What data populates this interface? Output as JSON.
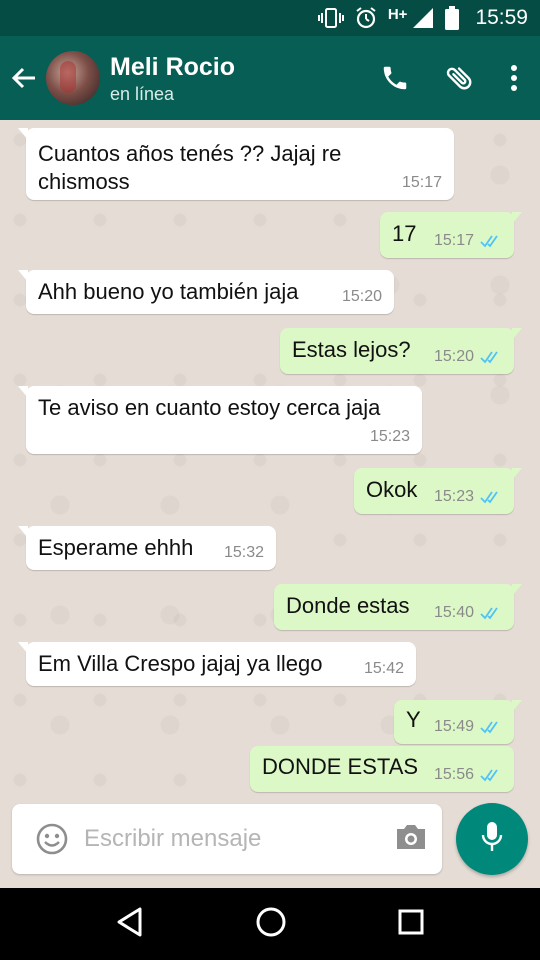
{
  "status_bar": {
    "time": "15:59",
    "network": "H+",
    "icons": [
      "vibrate-icon",
      "alarm-icon",
      "signal-icon",
      "battery-icon"
    ]
  },
  "header": {
    "contact_name": "Meli Rocio",
    "status": "en línea",
    "icons": [
      "back-arrow-icon",
      "phone-icon",
      "attach-icon",
      "more-icon"
    ]
  },
  "messages": [
    {
      "dir": "in",
      "text_lines": [
        "Cuantos años tenés ?? Jajaj re",
        "chismoss"
      ],
      "time": "15:17"
    },
    {
      "dir": "out",
      "text_lines": [
        "17"
      ],
      "time": "15:17",
      "status": "read"
    },
    {
      "dir": "in",
      "text_lines": [
        "Ahh bueno yo también jaja"
      ],
      "time": "15:20"
    },
    {
      "dir": "out",
      "text_lines": [
        "Estas lejos?"
      ],
      "time": "15:20",
      "status": "read"
    },
    {
      "dir": "in",
      "text_lines": [
        "Te aviso en cuanto estoy cerca jaja"
      ],
      "time": "15:23"
    },
    {
      "dir": "out",
      "text_lines": [
        "Okok"
      ],
      "time": "15:23",
      "status": "read"
    },
    {
      "dir": "in",
      "text_lines": [
        "Esperame ehhh"
      ],
      "time": "15:32"
    },
    {
      "dir": "out",
      "text_lines": [
        "Donde estas"
      ],
      "time": "15:40",
      "status": "read"
    },
    {
      "dir": "in",
      "text_lines": [
        "Em Villa Crespo jajaj ya llego"
      ],
      "time": "15:42"
    },
    {
      "dir": "out",
      "text_lines": [
        "Y"
      ],
      "time": "15:49",
      "status": "read"
    },
    {
      "dir": "out",
      "text_lines": [
        "DONDE ESTAS"
      ],
      "time": "15:56",
      "status": "read"
    }
  ],
  "composer": {
    "placeholder": "Escribir mensaje"
  },
  "colors": {
    "header": "#075e54",
    "status_bar": "#054d44",
    "outgoing_bubble": "#dcf8c6",
    "incoming_bubble": "#ffffff",
    "read_tick": "#4fc3f7",
    "mic_button": "#00897b"
  }
}
